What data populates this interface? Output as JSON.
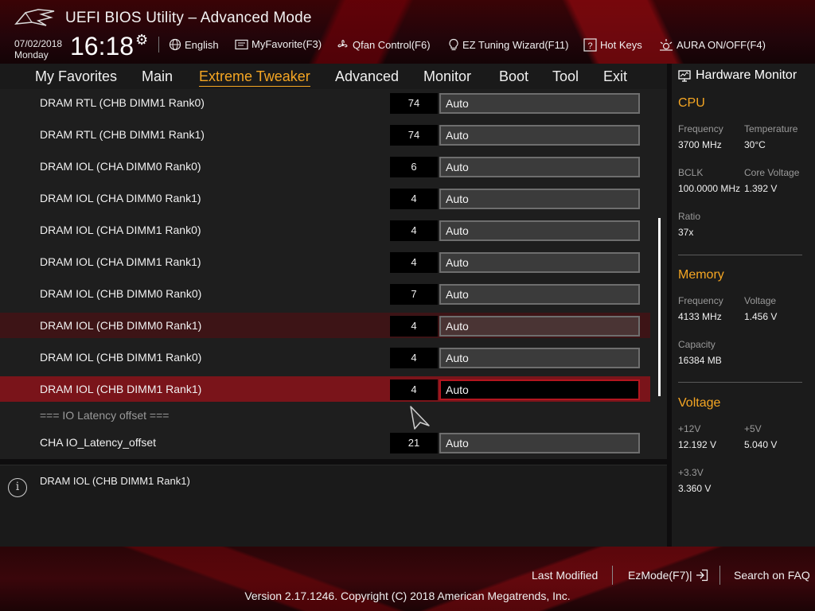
{
  "header": {
    "title": "UEFI BIOS Utility – Advanced Mode",
    "date": "07/02/2018",
    "weekday": "Monday",
    "time": "16:18",
    "tools": {
      "language": "English",
      "favorite": "MyFavorite(F3)",
      "qfan": "Qfan Control(F6)",
      "ez_tuning": "EZ Tuning Wizard(F11)",
      "hotkeys": "Hot Keys",
      "aura": "AURA ON/OFF(F4)"
    }
  },
  "menu": {
    "items": [
      "My Favorites",
      "Main",
      "Extreme Tweaker",
      "Advanced",
      "Monitor",
      "Boot",
      "Tool",
      "Exit"
    ],
    "active": "Extreme Tweaker"
  },
  "settings": {
    "rows": [
      {
        "label": "DRAM RTL (CHB DIMM1 Rank0)",
        "value": "74",
        "option": "Auto"
      },
      {
        "label": "DRAM RTL (CHB DIMM1 Rank1)",
        "value": "74",
        "option": "Auto"
      },
      {
        "label": "DRAM IOL (CHA DIMM0 Rank0)",
        "value": "6",
        "option": "Auto"
      },
      {
        "label": "DRAM IOL (CHA DIMM0 Rank1)",
        "value": "4",
        "option": "Auto"
      },
      {
        "label": "DRAM IOL (CHA DIMM1 Rank0)",
        "value": "4",
        "option": "Auto"
      },
      {
        "label": "DRAM IOL (CHA DIMM1 Rank1)",
        "value": "4",
        "option": "Auto"
      },
      {
        "label": "DRAM IOL (CHB DIMM0 Rank0)",
        "value": "7",
        "option": "Auto"
      },
      {
        "label": "DRAM IOL (CHB DIMM0 Rank1)",
        "value": "4",
        "option": "Auto"
      },
      {
        "label": "DRAM IOL (CHB DIMM1 Rank0)",
        "value": "4",
        "option": "Auto"
      },
      {
        "label": "DRAM IOL (CHB DIMM1 Rank1)",
        "value": "4",
        "option": "Auto"
      }
    ],
    "section_header": "=== IO Latency offset ===",
    "last_row": {
      "label": "CHA IO_Latency_offset",
      "value": "21",
      "option": "Auto"
    }
  },
  "help": {
    "text": "DRAM IOL (CHB DIMM1 Rank1)"
  },
  "hw_monitor": {
    "title": "Hardware Monitor",
    "cpu": {
      "heading": "CPU",
      "frequency_label": "Frequency",
      "frequency": "3700 MHz",
      "temperature_label": "Temperature",
      "temperature": "30°C",
      "bclk_label": "BCLK",
      "bclk": "100.0000 MHz",
      "core_voltage_label": "Core Voltage",
      "core_voltage": "1.392 V",
      "ratio_label": "Ratio",
      "ratio": "37x"
    },
    "memory": {
      "heading": "Memory",
      "frequency_label": "Frequency",
      "frequency": "4133 MHz",
      "voltage_label": "Voltage",
      "voltage": "1.456 V",
      "capacity_label": "Capacity",
      "capacity": "16384 MB"
    },
    "voltage": {
      "heading": "Voltage",
      "v12_label": "+12V",
      "v12": "12.192 V",
      "v5_label": "+5V",
      "v5": "5.040 V",
      "v33_label": "+3.3V",
      "v33": "3.360 V"
    }
  },
  "footer": {
    "last_modified": "Last Modified",
    "ezmode": "EzMode(F7)|",
    "search_faq": "Search on FAQ",
    "copyright": "Version 2.17.1246. Copyright (C) 2018 American Megatrends, Inc."
  },
  "colors": {
    "accent": "#f5a623",
    "selected_row": "#7a141a",
    "hover_row": "#3d1416"
  }
}
